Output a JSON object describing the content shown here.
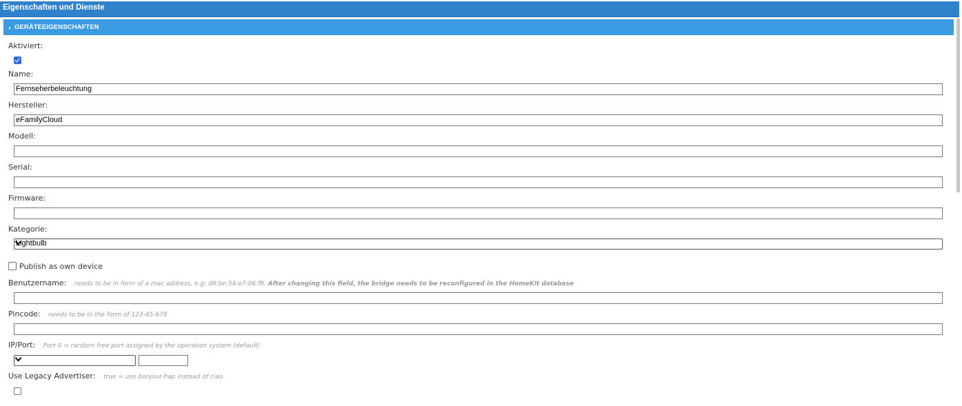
{
  "window": {
    "title": "Eigenschaften und Dienste"
  },
  "section": {
    "title": "GERÄTEEIGENSCHAFTEN"
  },
  "fields": {
    "aktiviert": {
      "label": "Aktiviert:",
      "checked": true
    },
    "name": {
      "label": "Name:",
      "value": "Fernseherbeleuchtung"
    },
    "hersteller": {
      "label": "Hersteller:",
      "value": "eFamilyCloud"
    },
    "modell": {
      "label": "Modell:",
      "value": ""
    },
    "serial": {
      "label": "Serial:",
      "value": ""
    },
    "firmware": {
      "label": "Firmware:",
      "value": ""
    },
    "kategorie": {
      "label": "Kategorie:",
      "selected": "Lightbulb"
    },
    "publish": {
      "label": "Publish as own device",
      "checked": false
    },
    "benutzername": {
      "label": "Benutzername:",
      "hint": "needs to be in form of a mac address, e.g: d8:be:54:e7:06:f8.",
      "hint_bold": "After changing this field, the bridge needs to be reconfigured in the HomeKit database",
      "value": ""
    },
    "pincode": {
      "label": "Pincode:",
      "hint": "needs to be in the form of 123-45-678",
      "value": ""
    },
    "ipport": {
      "label": "IP/Port:",
      "hint": "Port 0 = random free port assigned by the operation system (default)",
      "ip": "",
      "port": ""
    },
    "legacy": {
      "label": "Use Legacy Advertiser:",
      "hint": "true = use bonjour-hap instead of ciao",
      "checked": false
    }
  },
  "colors": {
    "titlebar": "#2f82c9",
    "section_header": "#3a9be3",
    "checkbox_checked": "#2f6fd8"
  }
}
